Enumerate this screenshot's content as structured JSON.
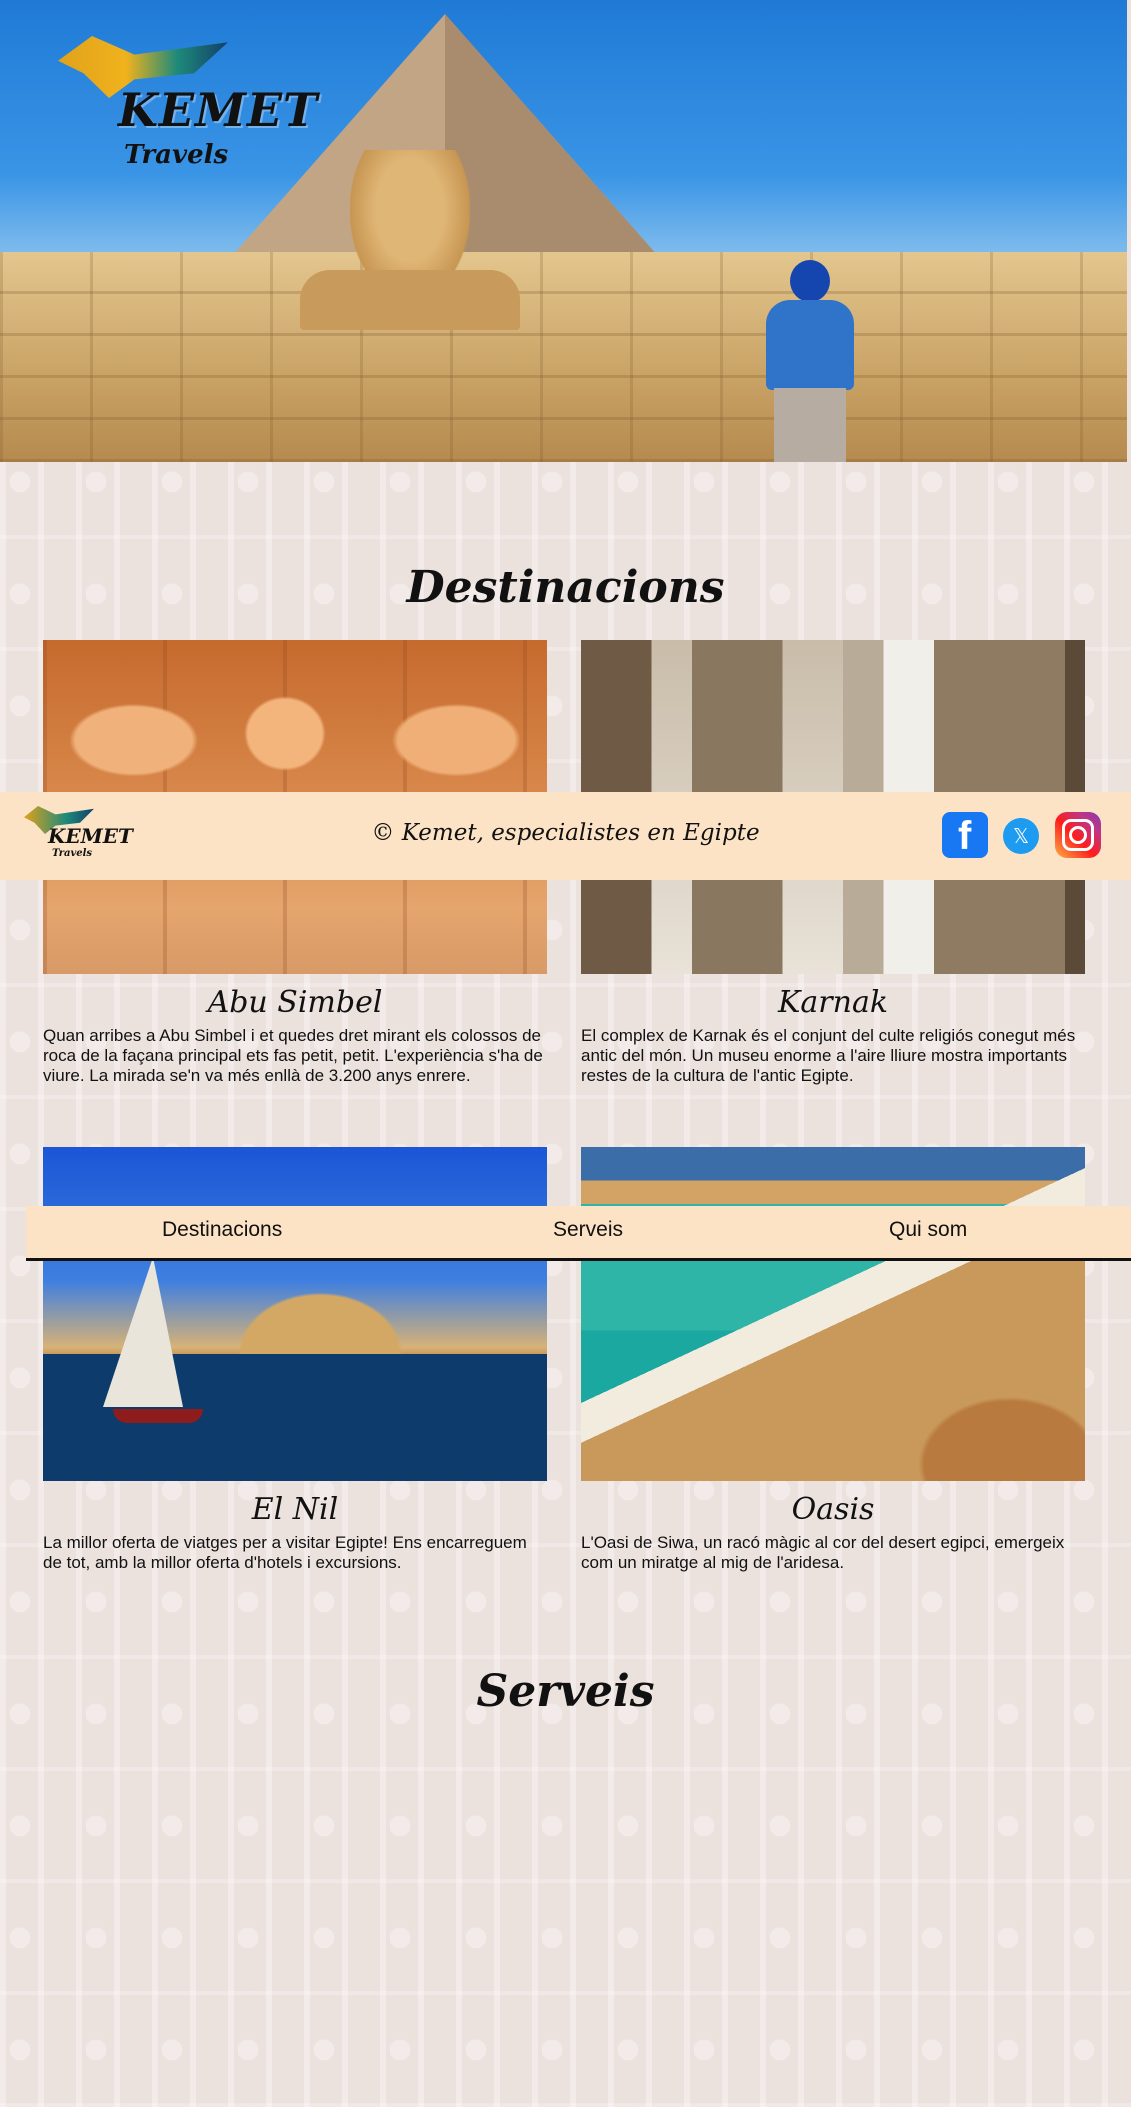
{
  "brand": {
    "name": "KEMET",
    "tagline": "Travels"
  },
  "sections": {
    "destinations_title": "Destinacions",
    "services_title": "Serveis"
  },
  "destinations": [
    {
      "name": "Abu Simbel",
      "description": "Quan arribes a Abu Simbel i et quedes dret mirant els colossos de roca de la façana principal ets fas petit, petit. L'experiència s'ha de viure. La mirada se'n va més enllà de 3.200 anys enrere."
    },
    {
      "name": "Karnak",
      "description": "El complex de Karnak és el conjunt del culte religiós conegut més antic del món. Un museu enorme a l'aire lliure mostra importants restes de la cultura de l'antic Egipte."
    },
    {
      "name": "El Nil",
      "description": "La millor oferta de viatges per a visitar Egipte! Ens encarreguem de tot, amb la millor oferta d'hotels i excursions."
    },
    {
      "name": "Oasis",
      "description": "L'Oasi de Siwa, un racó màgic al cor del desert egipci, emergeix com un miratge al mig de l'aridesa."
    }
  ],
  "footer": {
    "copyright": "© Kemet, especialistes en Egipte",
    "social": [
      "facebook-icon",
      "x-twitter-icon",
      "instagram-icon"
    ]
  },
  "nav": {
    "items": [
      "Destinacions",
      "Serveis",
      "Qui som"
    ]
  },
  "colors": {
    "bar_background": "#fce3c6",
    "page_background": "#ebe1dd",
    "text": "#111111"
  }
}
